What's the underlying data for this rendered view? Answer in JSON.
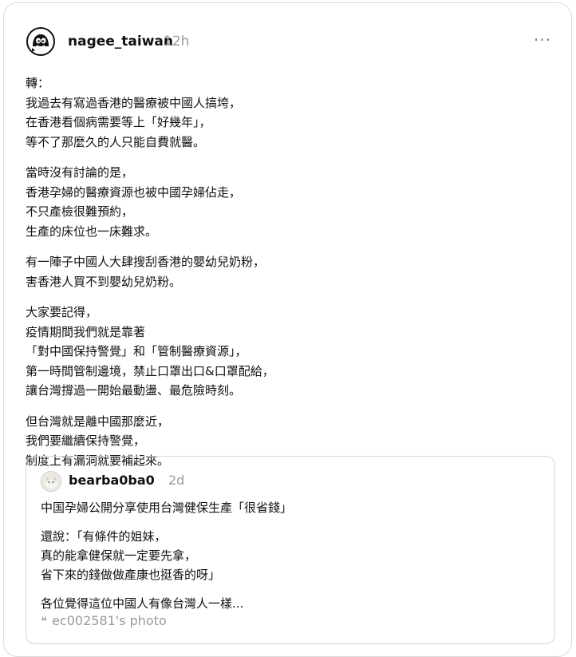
{
  "post": {
    "username": "nagee_taiwan",
    "time": "12h",
    "more_icon": "···",
    "paragraphs": [
      [
        "轉：",
        "我過去有寫過香港的醫療被中國人搞垮，",
        "在香港看個病需要等上「好幾年」，",
        "等不了那麼久的人只能自費就醫。"
      ],
      [
        "當時沒有討論的是，",
        "香港孕婦的醫療資源也被中國孕婦佔走，",
        "不只產檢很難預約，",
        "生產的床位也一床難求。"
      ],
      [
        "有一陣子中國人大肆搜刮香港的嬰幼兒奶粉，",
        "害香港人買不到嬰幼兒奶粉。"
      ],
      [
        "大家要記得，",
        "疫情期間我們就是靠著",
        "「對中國保持警覺」和「管制醫療資源」，",
        "第一時間管制邊境，禁止口罩出口&口罩配給，",
        "讓台灣撐過一開始最動盪、最危險時刻。"
      ],
      [
        "但台灣就是離中國那麼近，",
        "我們要繼續保持警覺，",
        "制度上有漏洞就要補起來。"
      ]
    ]
  },
  "quote": {
    "username": "bearba0ba0",
    "time": "2d",
    "paragraphs": [
      [
        "中国孕婦公開分享使用台灣健保生產「很省錢」"
      ],
      [
        "還說：「有條件的姐妹，",
        "真的能拿健保就一定要先拿，",
        "省下來的錢做做產康也挺香的呀」"
      ]
    ],
    "truncated": "各位覺得這位中國人有像台灣人一樣...",
    "footer": "ec002581's photo",
    "footer_icon": "❝"
  }
}
